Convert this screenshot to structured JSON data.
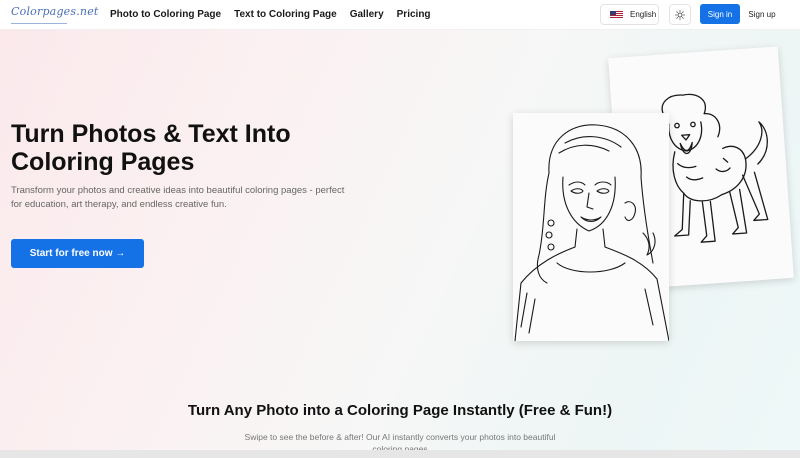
{
  "header": {
    "logo_text": "Colorpages.net",
    "nav": [
      {
        "label": "Photo to Coloring Page"
      },
      {
        "label": "Text to Coloring Page"
      },
      {
        "label": "Gallery"
      },
      {
        "label": "Pricing"
      }
    ],
    "language": "English",
    "theme_icon": "sun-icon",
    "signin_label": "Sign in",
    "signup_label": "Sign up"
  },
  "hero": {
    "title": "Turn Photos & Text Into Coloring Pages",
    "description": "Transform your photos and creative ideas into beautiful coloring pages - perfect for education, art therapy, and endless creative fun.",
    "cta_label": "Start for free now →"
  },
  "section": {
    "title": "Turn Any Photo into a Coloring Page Instantly (Free & Fun!)",
    "description": "Swipe to see the before & after! Our AI instantly converts your photos into beautiful coloring pages"
  },
  "colors": {
    "primary": "#1472e6",
    "logo": "#4a6fb5"
  }
}
